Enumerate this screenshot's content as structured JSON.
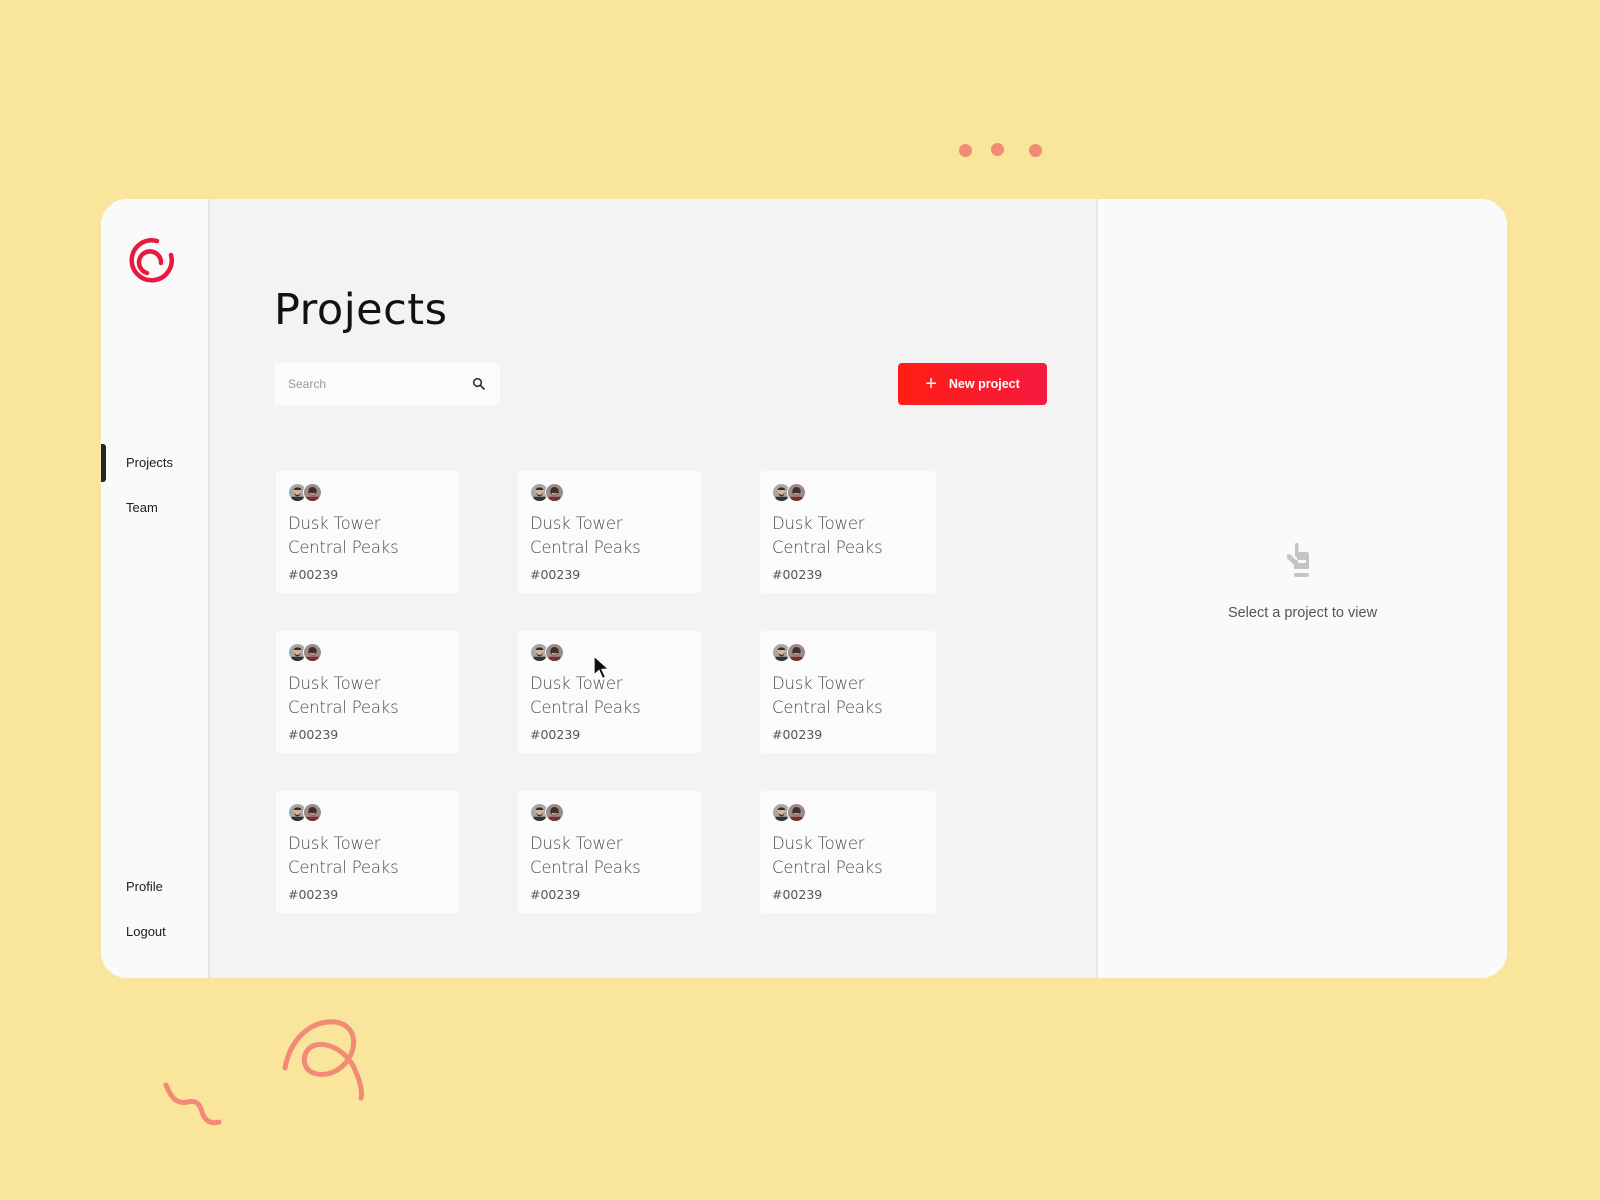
{
  "sidebar": {
    "logo": "brand-logo",
    "items": [
      {
        "label": "Projects",
        "active": true
      },
      {
        "label": "Team",
        "active": false
      }
    ],
    "bottom_items": [
      {
        "label": "Profile"
      },
      {
        "label": "Logout"
      }
    ]
  },
  "main": {
    "title": "Projects",
    "search": {
      "placeholder": "Search",
      "value": "",
      "icon": "search-icon"
    },
    "new_button": {
      "label": "New project",
      "icon": "plus-icon"
    },
    "projects": [
      {
        "line1": "Dusk Tower",
        "line2": "Central Peaks",
        "id": "#00239"
      },
      {
        "line1": "Dusk Tower",
        "line2": "Central Peaks",
        "id": "#00239"
      },
      {
        "line1": "Dusk Tower",
        "line2": "Central Peaks",
        "id": "#00239"
      },
      {
        "line1": "Dusk Tower",
        "line2": "Central Peaks",
        "id": "#00239"
      },
      {
        "line1": "Dusk Tower",
        "line2": "Central Peaks",
        "id": "#00239"
      },
      {
        "line1": "Dusk Tower",
        "line2": "Central Peaks",
        "id": "#00239"
      },
      {
        "line1": "Dusk Tower",
        "line2": "Central Peaks",
        "id": "#00239"
      },
      {
        "line1": "Dusk Tower",
        "line2": "Central Peaks",
        "id": "#00239"
      },
      {
        "line1": "Dusk Tower",
        "line2": "Central Peaks",
        "id": "#00239"
      }
    ]
  },
  "detail": {
    "empty_text": "Select a project to view",
    "empty_icon": "pointing-hand-icon"
  },
  "colors": {
    "background": "#f9e59c",
    "accent": "#ff1e14",
    "logo": "#e8193c",
    "decoration": "#f28a76"
  }
}
